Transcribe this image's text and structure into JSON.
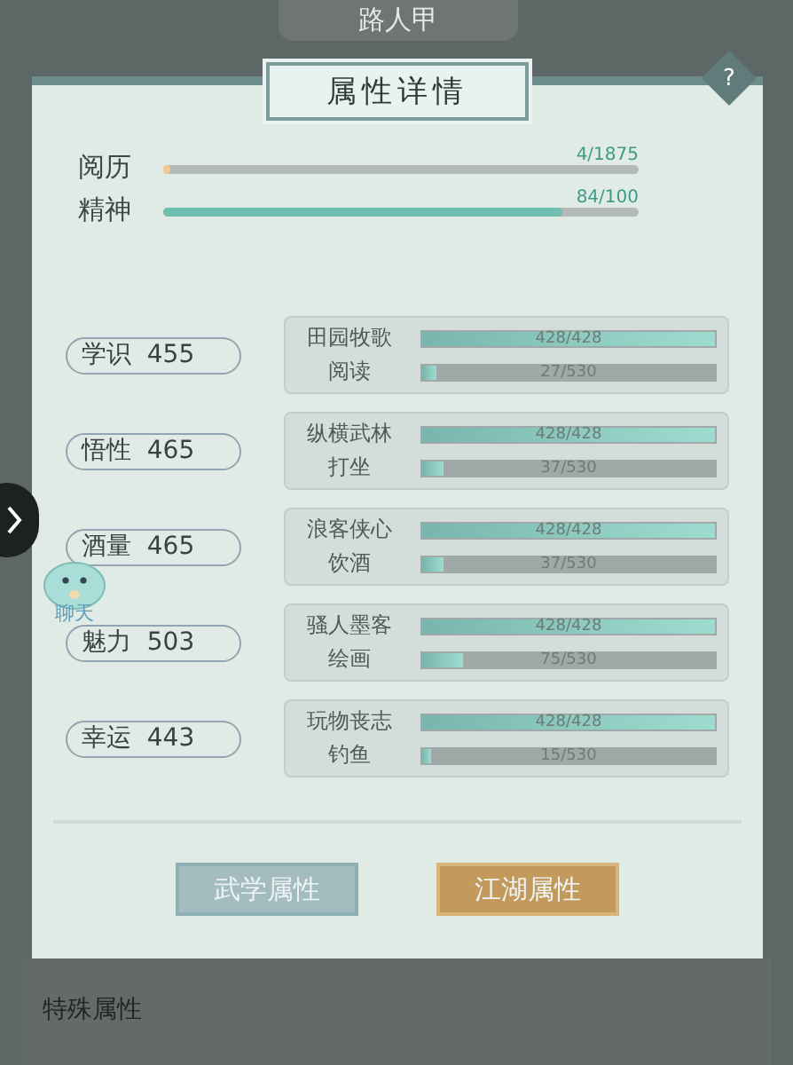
{
  "character_name": "路人甲",
  "dialog": {
    "title": "属性详情",
    "help": "?"
  },
  "meters": [
    {
      "label": "阅历",
      "reading": "4/1875",
      "level": 0.002
    },
    {
      "label": "精神",
      "reading": "84/100",
      "level": 0.84
    }
  ],
  "attributes": [
    {
      "name": "学识",
      "value": "455",
      "skills": [
        {
          "name": "田园牧歌",
          "reading": "428/428",
          "level": 1
        },
        {
          "name": "阅读",
          "reading": "27/530",
          "level": 0.051
        }
      ]
    },
    {
      "name": "悟性",
      "value": "465",
      "skills": [
        {
          "name": "纵横武林",
          "reading": "428/428",
          "level": 1
        },
        {
          "name": "打坐",
          "reading": "37/530",
          "level": 0.07
        }
      ]
    },
    {
      "name": "酒量",
      "value": "465",
      "skills": [
        {
          "name": "浪客侠心",
          "reading": "428/428",
          "level": 1
        },
        {
          "name": "饮酒",
          "reading": "37/530",
          "level": 0.07
        }
      ]
    },
    {
      "name": "魅力",
      "value": "503",
      "skills": [
        {
          "name": "骚人墨客",
          "reading": "428/428",
          "level": 1
        },
        {
          "name": "绘画",
          "reading": "75/530",
          "level": 0.142
        }
      ]
    },
    {
      "name": "幸运",
      "value": "443",
      "skills": [
        {
          "name": "玩物丧志",
          "reading": "428/428",
          "level": 1
        },
        {
          "name": "钓鱼",
          "reading": "15/530",
          "level": 0.028
        }
      ]
    }
  ],
  "tabs": [
    {
      "label": "武学属性",
      "selected": false
    },
    {
      "label": "江湖属性",
      "selected": true
    }
  ],
  "chat": {
    "label": "聊天"
  },
  "background_section": {
    "title": "特殊属性"
  }
}
